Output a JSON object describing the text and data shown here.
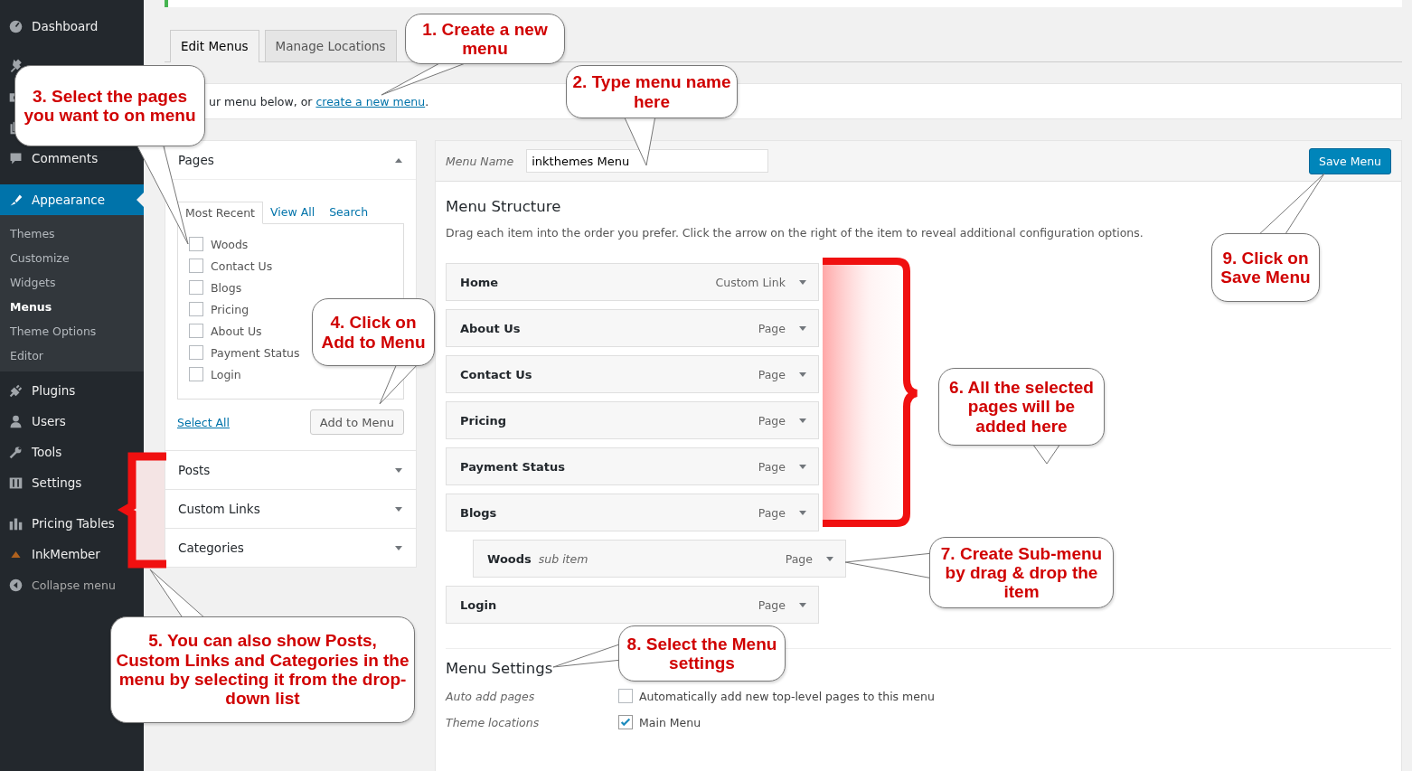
{
  "sidebar": {
    "items": [
      {
        "label": "Dashboard",
        "selected": false
      },
      {
        "label": "Comments",
        "selected": false
      },
      {
        "label": "Appearance",
        "selected": true,
        "children": [
          {
            "label": "Themes",
            "selected": false
          },
          {
            "label": "Customize",
            "selected": false
          },
          {
            "label": "Widgets",
            "selected": false
          },
          {
            "label": "Menus",
            "selected": true
          },
          {
            "label": "Theme Options",
            "selected": false
          },
          {
            "label": "Editor",
            "selected": false
          }
        ]
      },
      {
        "label": "Plugins",
        "selected": false
      },
      {
        "label": "Users",
        "selected": false
      },
      {
        "label": "Tools",
        "selected": false
      },
      {
        "label": "Settings",
        "selected": false
      },
      {
        "label": "Pricing Tables",
        "selected": false
      },
      {
        "label": "InkMember",
        "selected": false
      }
    ],
    "collapse": "Collapse menu"
  },
  "tabs": [
    {
      "label": "Edit Menus",
      "selected": true
    },
    {
      "label": "Manage Locations",
      "selected": false
    }
  ],
  "instruction": {
    "text": "ur menu below, or ",
    "link": "create a new menu",
    "end": "."
  },
  "sections": [
    {
      "title": "Pages",
      "expanded": true,
      "tabs": [
        {
          "label": "Most Recent",
          "selected": true
        },
        {
          "label": "View All",
          "selected": false
        },
        {
          "label": "Search",
          "selected": false
        }
      ],
      "items": [
        {
          "label": "Woods",
          "checked": false
        },
        {
          "label": "Contact Us",
          "checked": false
        },
        {
          "label": "Blogs",
          "checked": false
        },
        {
          "label": "Pricing",
          "checked": false
        },
        {
          "label": "About Us",
          "checked": false
        },
        {
          "label": "Payment Status",
          "checked": false
        },
        {
          "label": "Login",
          "checked": false
        }
      ],
      "select_all": "Select All",
      "add_button": "Add to Menu"
    },
    {
      "title": "Posts",
      "expanded": false
    },
    {
      "title": "Custom Links",
      "expanded": false
    },
    {
      "title": "Categories",
      "expanded": false
    }
  ],
  "menu_editor": {
    "name_label": "Menu Name",
    "name_value": "inkthemes Menu",
    "save_button": "Save Menu",
    "structure_title": "Menu Structure",
    "description": "Drag each item into the order you prefer. Click the arrow on the right of the item to reveal additional configuration options.",
    "items": [
      {
        "kind": "top",
        "label": "Home",
        "type": "Custom Link"
      },
      {
        "kind": "top",
        "label": "About Us",
        "type": "Page"
      },
      {
        "kind": "top",
        "label": "Contact Us",
        "type": "Page"
      },
      {
        "kind": "top",
        "label": "Pricing",
        "type": "Page"
      },
      {
        "kind": "top",
        "label": "Payment Status",
        "type": "Page"
      },
      {
        "kind": "top",
        "label": "Blogs",
        "type": "Page"
      },
      {
        "kind": "sub",
        "label": "Woods",
        "note": "sub item",
        "type": "Page"
      },
      {
        "kind": "top",
        "label": "Login",
        "type": "Page"
      }
    ],
    "settings_title": "Menu Settings",
    "settings": [
      {
        "label": "Auto add pages",
        "option": "Automatically add new top-level pages to this menu",
        "checked": false
      },
      {
        "label": "Theme locations",
        "option": "Main Menu",
        "checked": true
      }
    ]
  },
  "callouts": [
    {
      "text": "1. Create a new menu"
    },
    {
      "text": "3. Select the pages you want to on menu"
    },
    {
      "text": "2. Type menu name here"
    },
    {
      "text": "9. Click on Save Menu"
    },
    {
      "text": "4. Click on Add to Menu"
    },
    {
      "text": "6. All the selected pages will be added here"
    },
    {
      "text": "7. Create Sub-menu by drag & drop the item"
    },
    {
      "text": "5. You can also show Posts, Custom Links and Categories in the menu by selecting it from the drop-down list"
    },
    {
      "text": "8. Select the Menu settings"
    }
  ]
}
